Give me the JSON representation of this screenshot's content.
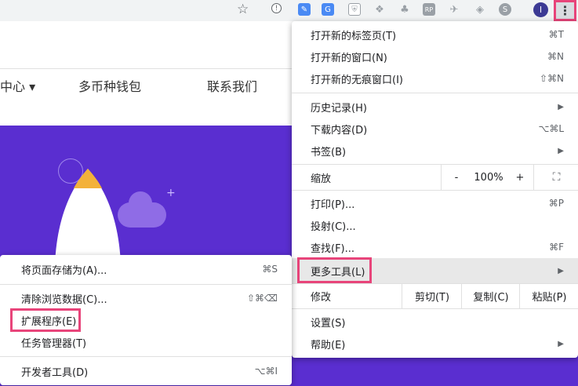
{
  "toolbar": {
    "avatar_letter": "I",
    "extension_icons": [
      {
        "icon": "info-circle-icon",
        "color": "#5f6368"
      },
      {
        "icon": "pen-icon",
        "color": "#4a8af4"
      },
      {
        "icon": "translate-icon",
        "color": "#4a8af4"
      },
      {
        "icon": "shield-icon",
        "color": "#9aa0a6"
      },
      {
        "icon": "dropbox-icon",
        "color": "#9aa0a6"
      },
      {
        "icon": "tree-icon",
        "color": "#9aa0a6"
      },
      {
        "icon": "rp-icon",
        "color": "#9aa0a6"
      },
      {
        "icon": "bird-icon",
        "color": "#9aa0a6"
      },
      {
        "icon": "fox-icon",
        "color": "#9aa0a6"
      },
      {
        "icon": "s-circle-icon",
        "color": "#9aa0a6"
      }
    ]
  },
  "site": {
    "nav": [
      "中心 ▾",
      "多币种钱包",
      "联系我们"
    ]
  },
  "menu": {
    "new_tab": {
      "label": "打开新的标签页(T)",
      "shortcut": "⌘T"
    },
    "new_window": {
      "label": "打开新的窗口(N)",
      "shortcut": "⌘N"
    },
    "new_incognito": {
      "label": "打开新的无痕窗口(I)",
      "shortcut": "⇧⌘N"
    },
    "history": {
      "label": "历史记录(H)"
    },
    "downloads": {
      "label": "下载内容(D)",
      "shortcut": "⌥⌘L"
    },
    "bookmarks": {
      "label": "书签(B)"
    },
    "zoom": {
      "label": "缩放",
      "minus": "-",
      "value": "100%",
      "plus": "+"
    },
    "print": {
      "label": "打印(P)...",
      "shortcut": "⌘P"
    },
    "cast": {
      "label": "投射(C)..."
    },
    "find": {
      "label": "查找(F)...",
      "shortcut": "⌘F"
    },
    "more_tools": {
      "label": "更多工具(L)"
    },
    "edit": {
      "label": "修改",
      "cut": "剪切(T)",
      "copy": "复制(C)",
      "paste": "粘贴(P)"
    },
    "settings": {
      "label": "设置(S)"
    },
    "help": {
      "label": "帮助(E)"
    }
  },
  "submenu": {
    "save_page": {
      "label": "将页面存储为(A)...",
      "shortcut": "⌘S"
    },
    "clear_data": {
      "label": "清除浏览数据(C)...",
      "shortcut": "⇧⌘⌫"
    },
    "extensions": {
      "label": "扩展程序(E)"
    },
    "task_manager": {
      "label": "任务管理器(T)"
    },
    "dev_tools": {
      "label": "开发者工具(D)",
      "shortcut": "⌥⌘I"
    }
  },
  "colors": {
    "highlight": "#e8447a",
    "hero": "#5a2ed0"
  }
}
